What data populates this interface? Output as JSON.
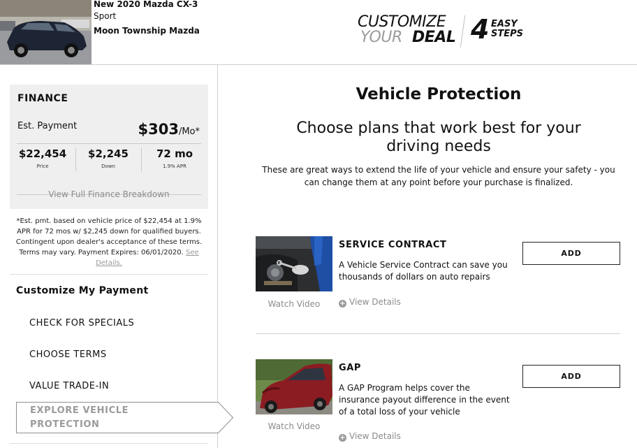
{
  "header": {
    "car_title": "New 2020 Mazda CX-3",
    "car_trim": "Sport",
    "dealer_name": "Moon Township Mazda",
    "brand": {
      "customize": "CUSTOMIZE",
      "your": "YOUR",
      "deal": "DEAL",
      "number": "4",
      "easy": "EASY",
      "steps": "STEPS"
    }
  },
  "finance": {
    "heading": "FINANCE",
    "est_label": "Est. Payment",
    "est_amount": "$303",
    "est_unit": "/Mo*",
    "columns": [
      {
        "value": "$22,454",
        "label": "Price"
      },
      {
        "value": "$2,245",
        "label": "Down"
      },
      {
        "value": "72 mo",
        "label": "1.9% APR"
      }
    ],
    "breakdown_link": "View Full Finance Breakdown",
    "disclaimer": "*Est. pmt. based on vehicle price of $22,454 at 1.9% APR for 72 mos w/ $2,245 down for qualified buyers. Contingent upon dealer's acceptance of these terms. Terms may vary. Payment Expires: 06/01/2020.",
    "see_details": "See Details."
  },
  "customize": {
    "title": "Customize My Payment",
    "steps": [
      "CHECK FOR SPECIALS",
      "CHOOSE TERMS",
      "VALUE TRADE-IN"
    ],
    "active_step_line1": "EXPLORE VEHICLE",
    "active_step_line2": "PROTECTION"
  },
  "main": {
    "title": "Vehicle Protection",
    "subtitle": "Choose plans that work best for your driving needs",
    "description": "These are great ways to extend the life of your vehicle and ensure your safety - you can change them at any point before your purchase is finalized."
  },
  "products": [
    {
      "name": "SERVICE CONTRACT",
      "description": "A Vehicle Service Contract can save you thousands of dollars on auto repairs",
      "watch_video": "Watch Video",
      "view_details": "View Details",
      "add_label": "ADD"
    },
    {
      "name": "GAP",
      "description": "A GAP Program helps cover the insurance payout difference in the event of a total loss of your vehicle",
      "watch_video": "Watch Video",
      "view_details": "View Details",
      "add_label": "ADD"
    }
  ]
}
